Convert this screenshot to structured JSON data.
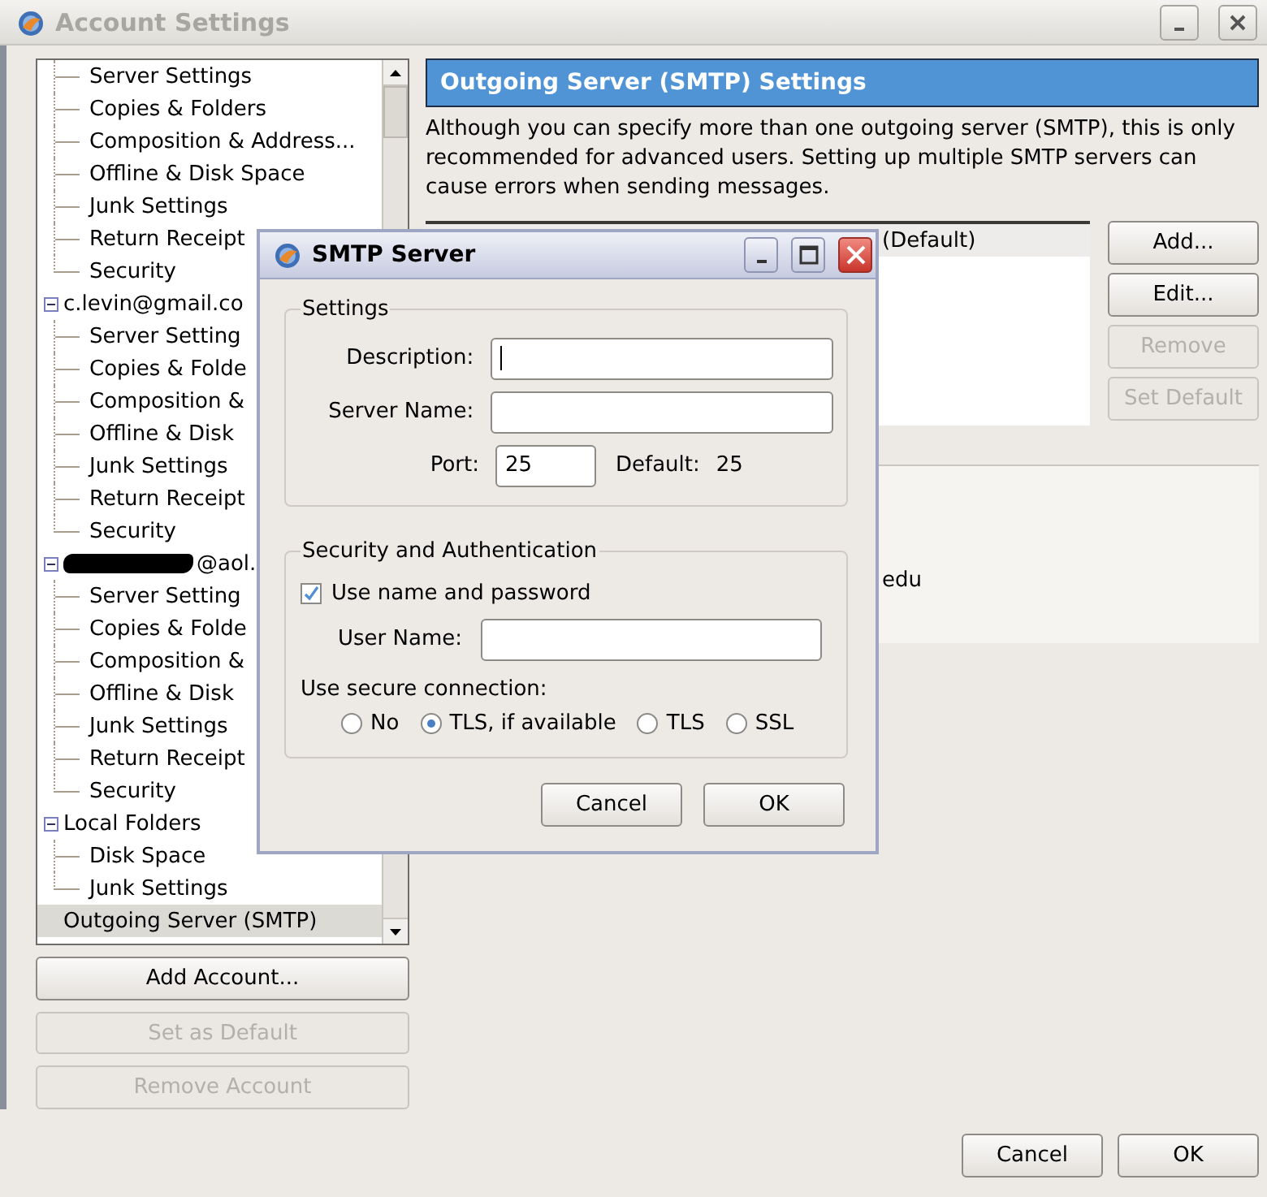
{
  "window": {
    "title": "Account Settings"
  },
  "tree": [
    {
      "children": [
        {
          "label": "Server Settings",
          "selected": false
        },
        {
          "label": "Copies & Folders",
          "selected": false
        },
        {
          "label": "Composition & Address...",
          "selected": false
        },
        {
          "label": "Offline & Disk Space",
          "selected": false
        },
        {
          "label": "Junk Settings",
          "selected": false
        },
        {
          "label": "Return Receipt",
          "selected": false
        },
        {
          "label": "Security",
          "selected": false
        }
      ]
    },
    {
      "label": "c.levin@gmail.co",
      "expanded": true,
      "selected": false,
      "children": [
        {
          "label": "Server Setting",
          "selected": false
        },
        {
          "label": "Copies & Folde",
          "selected": false
        },
        {
          "label": "Composition &",
          "selected": false
        },
        {
          "label": "Offline & Disk",
          "selected": false
        },
        {
          "label": "Junk Settings",
          "selected": false
        },
        {
          "label": "Return Receipt",
          "selected": false
        },
        {
          "label": "Security",
          "selected": false
        }
      ]
    },
    {
      "label": "@aol.",
      "redacted": true,
      "expanded": true,
      "selected": false,
      "children": [
        {
          "label": "Server Setting",
          "selected": false
        },
        {
          "label": "Copies & Folde",
          "selected": false
        },
        {
          "label": "Composition &",
          "selected": false
        },
        {
          "label": "Offline & Disk",
          "selected": false
        },
        {
          "label": "Junk Settings",
          "selected": false
        },
        {
          "label": "Return Receipt",
          "selected": false
        },
        {
          "label": "Security",
          "selected": false
        }
      ]
    },
    {
      "label": "Local Folders",
      "expanded": true,
      "selected": false,
      "children": [
        {
          "label": "Disk Space",
          "selected": false
        },
        {
          "label": "Junk Settings",
          "selected": false
        }
      ]
    },
    {
      "label": "Outgoing Server (SMTP)",
      "selected": true
    }
  ],
  "account_buttons": [
    {
      "label": "Add Account...",
      "disabled": false
    },
    {
      "label": "Set as Default",
      "disabled": true
    },
    {
      "label": "Remove Account",
      "disabled": true
    }
  ],
  "panel": {
    "title": "Outgoing Server (SMTP) Settings",
    "description": "Although you can specify more than one outgoing server (SMTP), this is only recommended for advanced users. Setting up multiple SMTP servers can cause errors when sending messages.",
    "servers": [
      {
        "label": "(Default)",
        "selected": true
      }
    ],
    "server_buttons": [
      {
        "label": "Add...",
        "disabled": false
      },
      {
        "label": "Edit...",
        "disabled": false
      },
      {
        "label": "Remove",
        "disabled": true
      },
      {
        "label": "Set Default",
        "disabled": true
      }
    ],
    "details": [
      "edu"
    ]
  },
  "buttons": [
    {
      "label": "Cancel"
    },
    {
      "label": "OK"
    }
  ],
  "dialog": {
    "title": "SMTP Server",
    "settings": {
      "legend": "Settings",
      "description_label": "Description:",
      "description_focused": true,
      "server_label": "Server Name:",
      "port_label": "Port:",
      "port": "25",
      "default_label": "Default:",
      "default_port": "25"
    },
    "security": {
      "legend": "Security and Authentication",
      "use_password": {
        "label": "Use name and password",
        "checked": true
      },
      "user_label": "User Name:",
      "connection_label": "Use secure connection:",
      "options": [
        {
          "label": "No",
          "selected": false
        },
        {
          "label": "TLS, if available",
          "selected": true
        },
        {
          "label": "TLS",
          "selected": false
        },
        {
          "label": "SSL",
          "selected": false
        }
      ]
    },
    "buttons": [
      {
        "label": "Cancel"
      },
      {
        "label": "OK"
      }
    ]
  }
}
